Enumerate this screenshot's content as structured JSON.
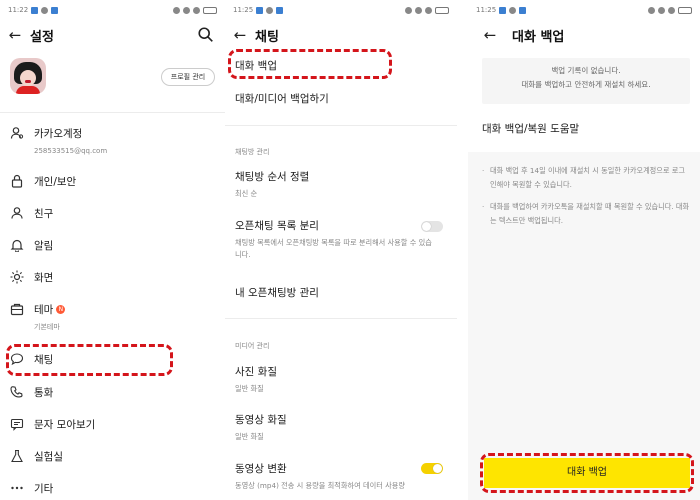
{
  "panel1": {
    "status": {
      "time": "11:22"
    },
    "title": "설정",
    "profile_button": "프로필 관리",
    "account": {
      "label": "카카오계정",
      "email": "258533515@qq.com"
    },
    "items": [
      {
        "label": "개인/보안",
        "icon": "lock-icon"
      },
      {
        "label": "친구",
        "icon": "person-icon"
      },
      {
        "label": "알림",
        "icon": "bell-icon"
      },
      {
        "label": "화면",
        "icon": "sun-icon"
      },
      {
        "label": "테마",
        "icon": "theme-icon",
        "badge": "N",
        "sub": "기본테마"
      },
      {
        "label": "채팅",
        "icon": "chat-bubble-icon"
      },
      {
        "label": "통화",
        "icon": "phone-icon"
      },
      {
        "label": "문자 모아보기",
        "icon": "message-icon"
      },
      {
        "label": "실험실",
        "icon": "flask-icon"
      },
      {
        "label": "기타",
        "icon": "more-icon"
      }
    ]
  },
  "panel2": {
    "status": {
      "time": "11:25"
    },
    "title": "채팅",
    "backup": "대화 백업",
    "media_backup": "대화/미디어 백업하기",
    "section_chatroom": "채팅방 관리",
    "sort": {
      "title": "채팅방 순서 정렬",
      "value": "최신 순"
    },
    "openchat_split": {
      "title": "오픈채팅 목록 분리",
      "desc": "채팅방 목록에서 오픈채팅방 목록을 따로 분리해서 사용할 수 있습니다."
    },
    "my_openchat": "내 오픈채팅방 관리",
    "section_media": "미디어 관리",
    "photo_quality": {
      "title": "사진 화질",
      "value": "일반 화질"
    },
    "video_quality": {
      "title": "동영상 화질",
      "value": "일반 화질"
    },
    "video_convert": {
      "title": "동영상 변환",
      "desc": "동영상 (mp4) 전송 시 용량을 최적화하여 데이터 사용량"
    }
  },
  "panel3": {
    "status": {
      "time": "11:25"
    },
    "title": "대화 백업",
    "notice_line1": "백업 기록이 없습니다.",
    "notice_line2": "대화를 백업하고 안전하게 재설치 하세요.",
    "help": "대화 백업/복원 도움말",
    "bullet1": "대화 백업 후 14일 이내에 재설치 시 동일한 카카오계정으로 로그인해야 복원할 수 있습니다.",
    "bullet2": "대화를 백업하여 카카오톡을 재설치할 때 복원할 수 있습니다. 대화는 텍스트만 백업됩니다.",
    "button": "대화 백업"
  },
  "colors": {
    "accent_yellow": "#fee500",
    "highlight_red": "#d4151b"
  }
}
